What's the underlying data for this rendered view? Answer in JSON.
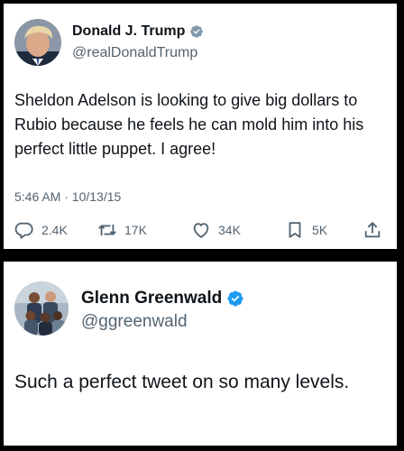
{
  "tweets": [
    {
      "display_name": "Donald J. Trump",
      "handle": "@realDonaldTrump",
      "verified": true,
      "text": "Sheldon Adelson is looking to give big dollars to Rubio because he feels he can mold him into his perfect little puppet. I agree!",
      "timestamp": "5:46 AM · 10/13/15",
      "stats": {
        "replies": "2.4K",
        "retweets": "17K",
        "likes": "34K",
        "bookmarks": "5K"
      }
    },
    {
      "display_name": "Glenn Greenwald",
      "handle": "@ggreenwald",
      "verified": true,
      "text": "Such a perfect tweet on so many levels."
    }
  ],
  "icons": {
    "verified": "verified-badge-icon",
    "reply": "reply-icon",
    "retweet": "retweet-icon",
    "like": "heart-icon",
    "bookmark": "bookmark-icon",
    "share": "share-icon"
  },
  "colors": {
    "text": "#0f1419",
    "secondary": "#536471",
    "verified_gray": "#829aab",
    "verified_blue": "#1d9bf0",
    "background": "#000000",
    "card": "#ffffff"
  }
}
